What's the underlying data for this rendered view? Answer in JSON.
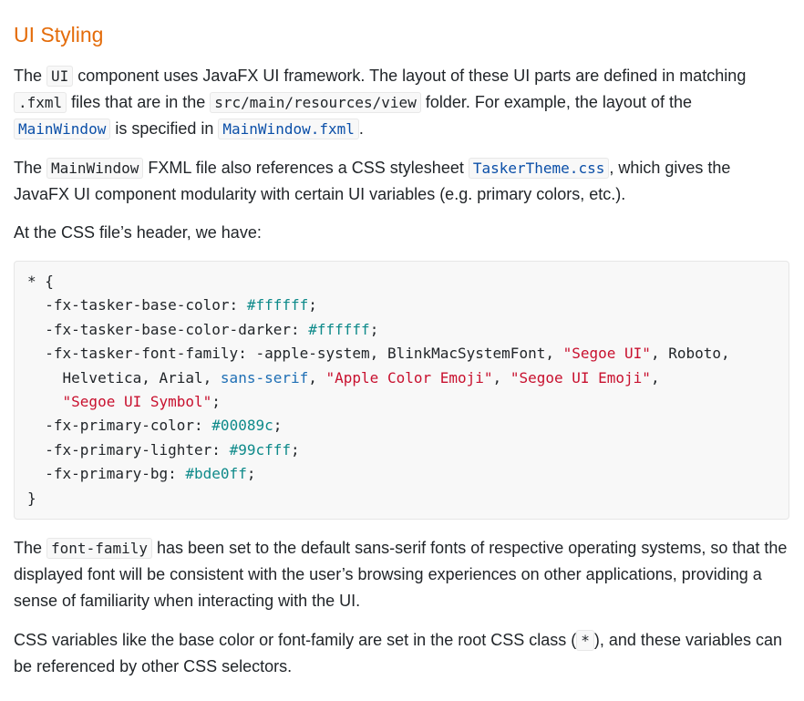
{
  "title": "UI Styling",
  "para1": {
    "t1": "The ",
    "c1": "UI",
    "t2": " component uses JavaFX UI framework. The layout of these UI parts are defined in matching ",
    "c2": ".fxml",
    "t3": " files that are in the ",
    "c3": "src/main/resources/view",
    "t4": " folder. For example, the layout of the ",
    "c4": "MainWindow",
    "t5": " is specified in ",
    "c5": "MainWindow.fxml",
    "t6": "."
  },
  "para2": {
    "t1": "The ",
    "c1": "MainWindow",
    "t2": " FXML file also references a CSS stylesheet ",
    "c2": "TaskerTheme.css",
    "t3": ", which gives the JavaFX UI component modularity with certain UI variables (e.g. primary colors, etc.)."
  },
  "para3": "At the CSS file’s header, we have:",
  "code": {
    "l1": "* {",
    "l2_prop": "  -fx-tasker-base-color: ",
    "l2_val": "#ffffff",
    "l3_prop": "  -fx-tasker-base-color-darker: ",
    "l3_val": "#ffffff",
    "l4_prop": "  -fx-tasker-font-family: -apple-system, BlinkMacSystemFont, ",
    "l4_s1": "\"Segoe UI\"",
    "l4_rest": ", Roboto,",
    "l5_a": "    Helvetica, Arial, ",
    "l5_kw": "sans-serif",
    "l5_c1": ", ",
    "l5_s1": "\"Apple Color Emoji\"",
    "l5_c2": ", ",
    "l5_s2": "\"Segoe UI Emoji\"",
    "l5_c3": ",",
    "l6_indent": "    ",
    "l6_s": "\"Segoe UI Symbol\"",
    "l6_end": ";",
    "l7_prop": "  -fx-primary-color: ",
    "l7_val": "#00089c",
    "l8_prop": "  -fx-primary-lighter: ",
    "l8_val": "#99cfff",
    "l9_prop": "  -fx-primary-bg: ",
    "l9_val": "#bde0ff",
    "semi": ";",
    "close": "}"
  },
  "para4": {
    "t1": "The ",
    "c1": "font-family",
    "t2": " has been set to the default sans-serif fonts of respective operating systems, so that the displayed font will be consistent with the user’s browsing experiences on other applications, providing a sense of familiarity when interacting with the UI."
  },
  "para5": {
    "t1": "CSS variables like the base color or font-family are set in the root CSS class (",
    "c1": "*",
    "t2": "), and these variables can be referenced by other CSS selectors."
  },
  "colors": {
    "heading": "#e46c0a",
    "code_link": "#0b4fa8",
    "code_number": "#0e8a8a",
    "code_string": "#c8102e",
    "code_keyword": "#1f6fb5"
  }
}
